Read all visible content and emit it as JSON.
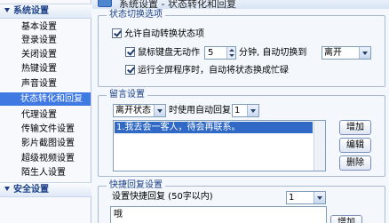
{
  "header": {
    "title": "系统设置 - 状态转化和回复"
  },
  "sidebar": {
    "group1": "系统设置",
    "items": [
      "基本设置",
      "登录设置",
      "关闭设置",
      "热键设置",
      "声音设置",
      "状态转化和回复",
      "代理设置",
      "传输文件设置",
      "影片截图设置",
      "超级视频设置",
      "陌生人设置"
    ],
    "selected_index": 5,
    "group2": "安全设置"
  },
  "status_switch": {
    "legend": "状态切换选项",
    "auto_switch_label": "允许自动转换状态项",
    "idle_label_before": "鼠标键盘无动作",
    "idle_minutes": "5",
    "idle_label_after": "分钟, 自动切换到",
    "idle_status": "离开",
    "fullscreen_label": "运行全屏程序时，自动将状态换成忙碌"
  },
  "message_settings": {
    "legend": "留言设置",
    "status_select": "离开状态",
    "when_label": "时使用自动回复",
    "reply_index": "1",
    "list_items": [
      "1.我去会一客人，待会再联系。"
    ],
    "add_button": "增加",
    "edit_button": "编辑",
    "delete_button": "删除"
  },
  "quick_reply": {
    "legend": "快捷回复设置",
    "label": "设置快捷回复 (50字以内)",
    "reply_index": "1",
    "text": "哦",
    "add_button": "增加"
  }
}
